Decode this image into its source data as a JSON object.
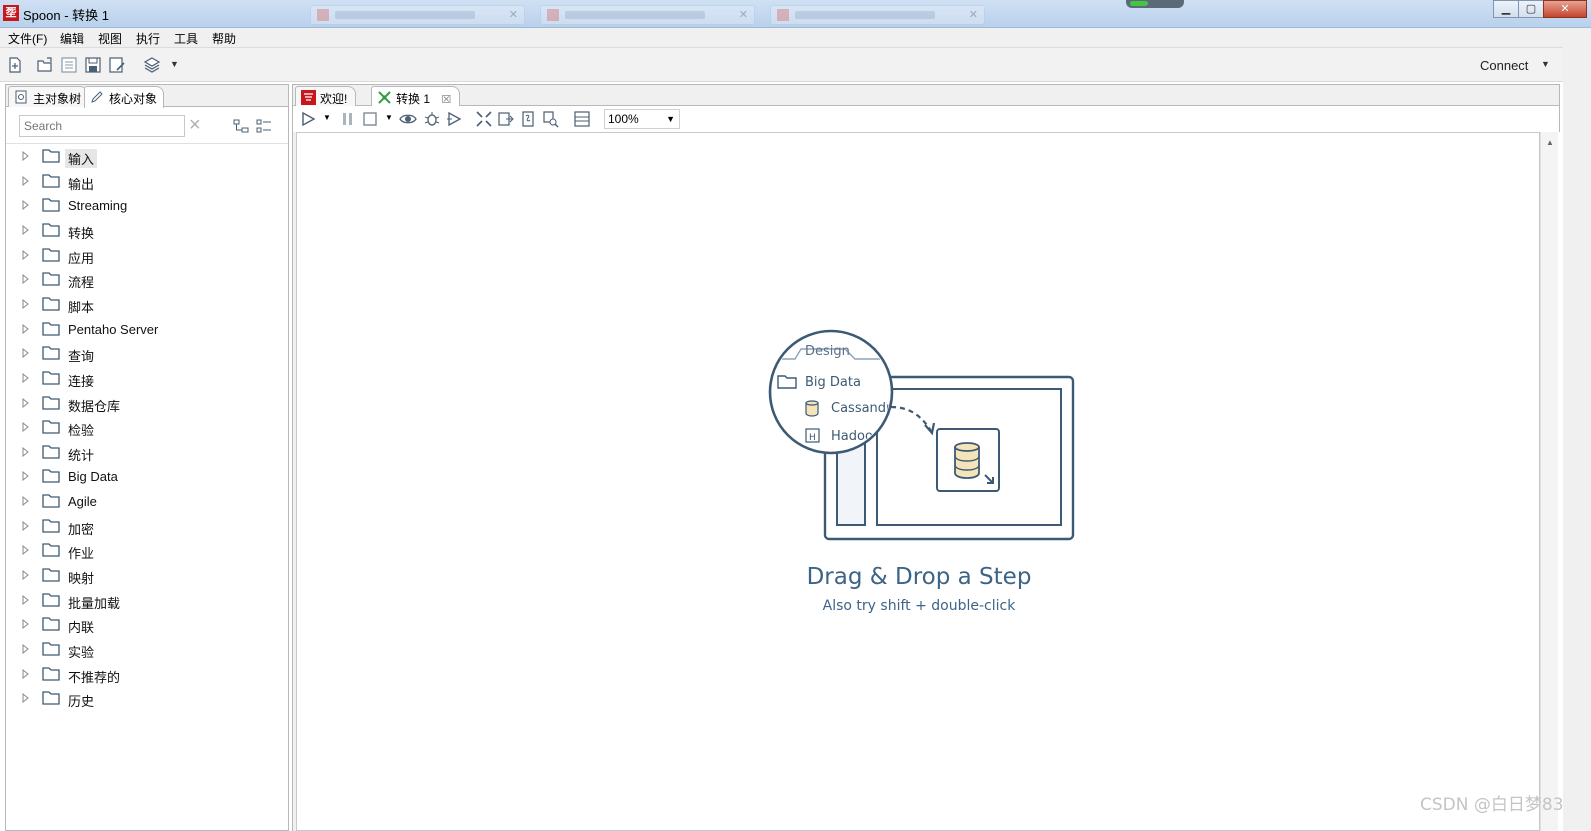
{
  "window": {
    "title": "Spoon - 转换 1",
    "app_icon_glyph": "㘸",
    "controls": {
      "minimize": "▁",
      "maximize": "▢",
      "close": "✕"
    }
  },
  "menubar": {
    "items": [
      "文件(F)",
      "编辑",
      "视图",
      "执行",
      "工具",
      "帮助"
    ]
  },
  "toolbar": {
    "connect_label": "Connect",
    "connect_caret": "▼",
    "perspective_caret": "▼"
  },
  "left_panel": {
    "tabs": [
      {
        "label": "主对象树",
        "icon": "object-tree-icon",
        "active": false
      },
      {
        "label": "核心对象",
        "icon": "pencil-icon",
        "active": true
      }
    ],
    "search": {
      "placeholder": "Search",
      "value": ""
    },
    "tree": [
      {
        "label": "输入",
        "selected": true
      },
      {
        "label": "输出"
      },
      {
        "label": "Streaming"
      },
      {
        "label": "转换"
      },
      {
        "label": "应用"
      },
      {
        "label": "流程"
      },
      {
        "label": "脚本"
      },
      {
        "label": "Pentaho Server"
      },
      {
        "label": "查询"
      },
      {
        "label": "连接"
      },
      {
        "label": "数据仓库"
      },
      {
        "label": "检验"
      },
      {
        "label": "统计"
      },
      {
        "label": "Big Data"
      },
      {
        "label": "Agile"
      },
      {
        "label": "加密"
      },
      {
        "label": "作业"
      },
      {
        "label": "映射"
      },
      {
        "label": "批量加载"
      },
      {
        "label": "内联"
      },
      {
        "label": "实验"
      },
      {
        "label": "不推荐的"
      },
      {
        "label": "历史"
      }
    ]
  },
  "editor": {
    "tabs": [
      {
        "label": "欢迎!",
        "icon": "spoon-logo-icon",
        "active": false
      },
      {
        "label": "转换 1",
        "icon": "transformation-icon",
        "active": true,
        "close": "☒"
      }
    ],
    "zoom": "100%",
    "zoom_caret": "▼",
    "placeholder": {
      "title": "Drag & Drop a Step",
      "subtitle": "Also try shift + double-click",
      "illustration": {
        "tab_label": "Design",
        "folder_label": "Big Data",
        "item1": "Cassandr",
        "item2": "Hadoop",
        "item2_glyph": "H"
      }
    }
  },
  "watermark": "CSDN @白日梦83",
  "colors": {
    "illustration_stroke": "#3d5a74",
    "placeholder_text": "#3d6487",
    "db_fill": "#f5e3b9",
    "close_button": "#c5442c"
  }
}
